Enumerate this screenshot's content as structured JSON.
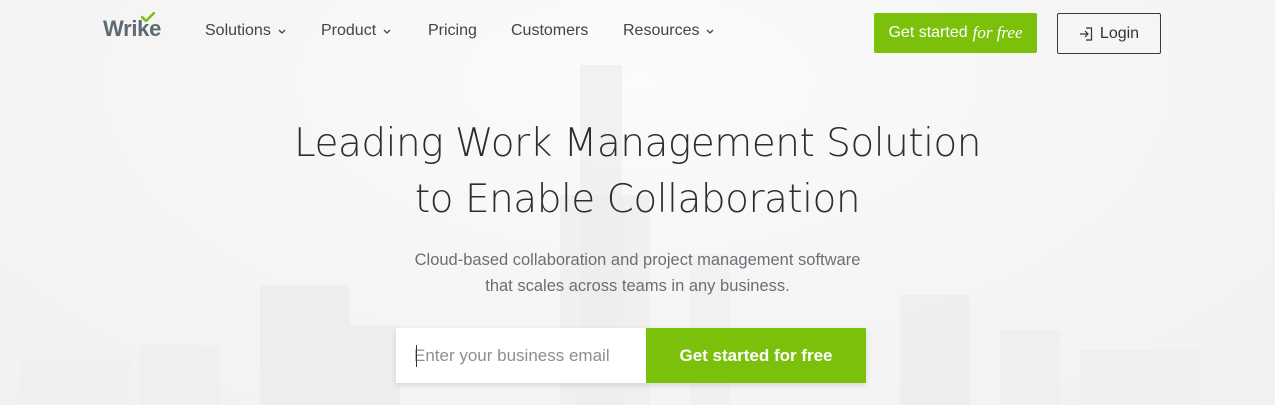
{
  "brand": {
    "logo_text": "Wrike",
    "accent_color": "#7bc10c"
  },
  "nav": {
    "items": [
      {
        "label": "Solutions",
        "has_dropdown": true
      },
      {
        "label": "Product",
        "has_dropdown": true
      },
      {
        "label": "Pricing",
        "has_dropdown": false
      },
      {
        "label": "Customers",
        "has_dropdown": false
      },
      {
        "label": "Resources",
        "has_dropdown": true
      }
    ],
    "cta": {
      "label": "Get started",
      "label_emphasis": "for free"
    },
    "login": {
      "label": "Login",
      "icon": "login-icon"
    }
  },
  "hero": {
    "title_line1": "Leading Work Management Solution",
    "title_line2": "to Enable Collaboration",
    "subtitle_line1": "Cloud-based collaboration and project management software",
    "subtitle_line2": "that scales across teams in any business.",
    "signup": {
      "email_placeholder": "Enter your business email",
      "email_value": "",
      "button_label": "Get started for free"
    }
  }
}
